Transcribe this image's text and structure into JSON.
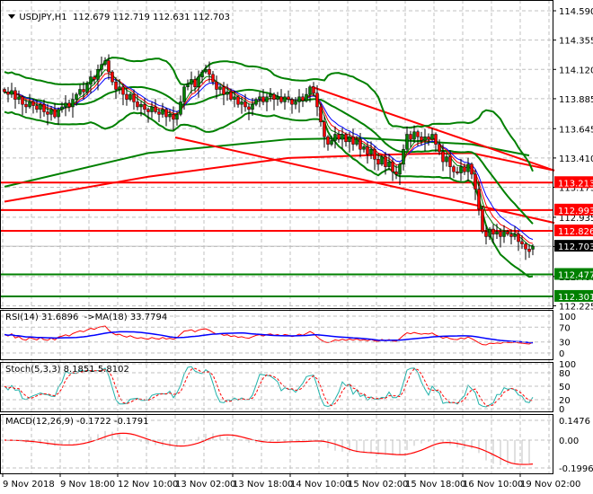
{
  "header": {
    "symbol": "USDJPY,H1",
    "ohlc": "112.679 112.719 112.631 112.703",
    "menu_icon": "triangle-down-icon"
  },
  "indicators": {
    "rsi_label": "RSI(14) 31.6896  ->MA(18) 33.7794",
    "stoch_label": "Stoch(5,3,3) 8.1851 5.8102",
    "macd_label": "MACD(12,26,9) -0.1722 -0.1791"
  },
  "colors": {
    "bull": "#008000",
    "bear": "#ff0000",
    "bands": "#008000",
    "level_red": "#ff0000",
    "level_green": "#008000",
    "current": "#000000",
    "rsi": "#ff0000",
    "rsi_ma": "#0000ff",
    "stoch_main": "#20b2aa",
    "stoch_signal": "#ff0000",
    "macd_hist": "#c0c0c0",
    "macd_signal": "#ff0000",
    "grid": "#c0c0c0"
  },
  "chart_data": {
    "type": "candlestick",
    "symbol": "USDJPY",
    "timeframe": "H1",
    "ylim": [
      112.225,
      114.59
    ],
    "price_ticks": [
      "114.590",
      "114.355",
      "114.120",
      "113.885",
      "113.645",
      "113.410",
      "113.175",
      "112.935",
      "112.700",
      "112.460",
      "112.225"
    ],
    "time_ticks": [
      "9 Nov 2018",
      "9 Nov 18:00",
      "12 Nov 10:00",
      "13 Nov 02:00",
      "13 Nov 18:00",
      "14 Nov 10:00",
      "15 Nov 02:00",
      "15 Nov 18:00",
      "16 Nov 10:00",
      "19 Nov 02:00"
    ],
    "closes": [
      113.94,
      113.92,
      113.95,
      113.88,
      113.9,
      113.84,
      113.82,
      113.86,
      113.83,
      113.8,
      113.84,
      113.78,
      113.76,
      113.8,
      113.74,
      113.8,
      113.82,
      113.85,
      113.82,
      113.88,
      113.92,
      113.96,
      113.94,
      114.0,
      114.06,
      114.04,
      114.12,
      114.16,
      114.19,
      114.1,
      114.02,
      113.96,
      113.98,
      113.92,
      113.88,
      113.92,
      113.86,
      113.82,
      113.84,
      113.8,
      113.78,
      113.82,
      113.78,
      113.76,
      113.8,
      113.74,
      113.76,
      113.72,
      113.76,
      113.86,
      113.98,
      114.0,
      114.04,
      113.98,
      114.06,
      114.1,
      114.12,
      114.08,
      114.02,
      113.96,
      113.98,
      113.92,
      113.94,
      113.88,
      113.9,
      113.84,
      113.86,
      113.82,
      113.8,
      113.84,
      113.88,
      113.9,
      113.86,
      113.9,
      113.92,
      113.88,
      113.9,
      113.86,
      113.9,
      113.88,
      113.84,
      113.86,
      113.9,
      113.87,
      113.92,
      113.98,
      113.93,
      113.82,
      113.7,
      113.58,
      113.52,
      113.55,
      113.6,
      113.56,
      113.6,
      113.54,
      113.58,
      113.52,
      113.56,
      113.48,
      113.5,
      113.44,
      113.48,
      113.4,
      113.36,
      113.42,
      113.34,
      113.38,
      113.3,
      113.28,
      113.36,
      113.48,
      113.6,
      113.56,
      113.62,
      113.58,
      113.55,
      113.58,
      113.56,
      113.6,
      113.52,
      113.46,
      113.38,
      113.42,
      113.34,
      113.3,
      113.29,
      113.34,
      113.3,
      113.36,
      113.28,
      113.16,
      113.0,
      112.82,
      112.78,
      112.84,
      112.8,
      112.82,
      112.78,
      112.82,
      112.8,
      112.78,
      112.8,
      112.74,
      112.72,
      112.68,
      112.66,
      112.703
    ],
    "last_bar": {
      "open": 112.679,
      "high": 112.719,
      "low": 112.631,
      "close": 112.703
    },
    "slow_ma_green": [
      [
        0,
        113.18
      ],
      [
        40,
        113.45
      ],
      [
        79,
        113.56
      ],
      [
        99,
        113.57
      ],
      [
        130,
        113.52
      ],
      [
        146,
        113.43
      ]
    ],
    "slow_ma_red": [
      [
        0,
        113.06
      ],
      [
        40,
        113.26
      ],
      [
        79,
        113.41
      ],
      [
        110,
        113.44
      ],
      [
        130,
        113.45
      ],
      [
        153,
        113.31
      ]
    ],
    "trendlines": [
      {
        "from_bar": 85.5,
        "from_price": 113.98,
        "to_bar": 153,
        "to_price": 113.31
      },
      {
        "from_bar": 47.5,
        "from_price": 113.575,
        "to_bar": 153,
        "to_price": 112.89
      }
    ],
    "levels": [
      {
        "price": 113.213,
        "label": "113.213",
        "kind": "red"
      },
      {
        "price": 112.993,
        "label": "112.993",
        "kind": "red"
      },
      {
        "price": 112.826,
        "label": "112.826",
        "kind": "red"
      },
      {
        "price": 112.477,
        "label": "112.477",
        "kind": "green"
      },
      {
        "price": 112.301,
        "label": "112.301",
        "kind": "green"
      }
    ],
    "current_price": {
      "price": 112.703,
      "label": "112.703"
    },
    "rsi": {
      "period": 14,
      "ma_period": 18,
      "ticks": [
        "100",
        "70",
        "30",
        "0"
      ],
      "value": 31.6896,
      "ma_value": 33.7794
    },
    "stoch": {
      "k": 5,
      "d": 3,
      "slowing": 3,
      "ticks": [
        "100",
        "80",
        "50",
        "20",
        "0"
      ],
      "main": 8.1851,
      "signal": 5.8102
    },
    "macd": {
      "fast": 12,
      "slow": 26,
      "signal": 9,
      "ticks": [
        "0.1476",
        "0.00",
        "-0.1996"
      ],
      "main": -0.1722,
      "signal_value": -0.1791
    }
  }
}
